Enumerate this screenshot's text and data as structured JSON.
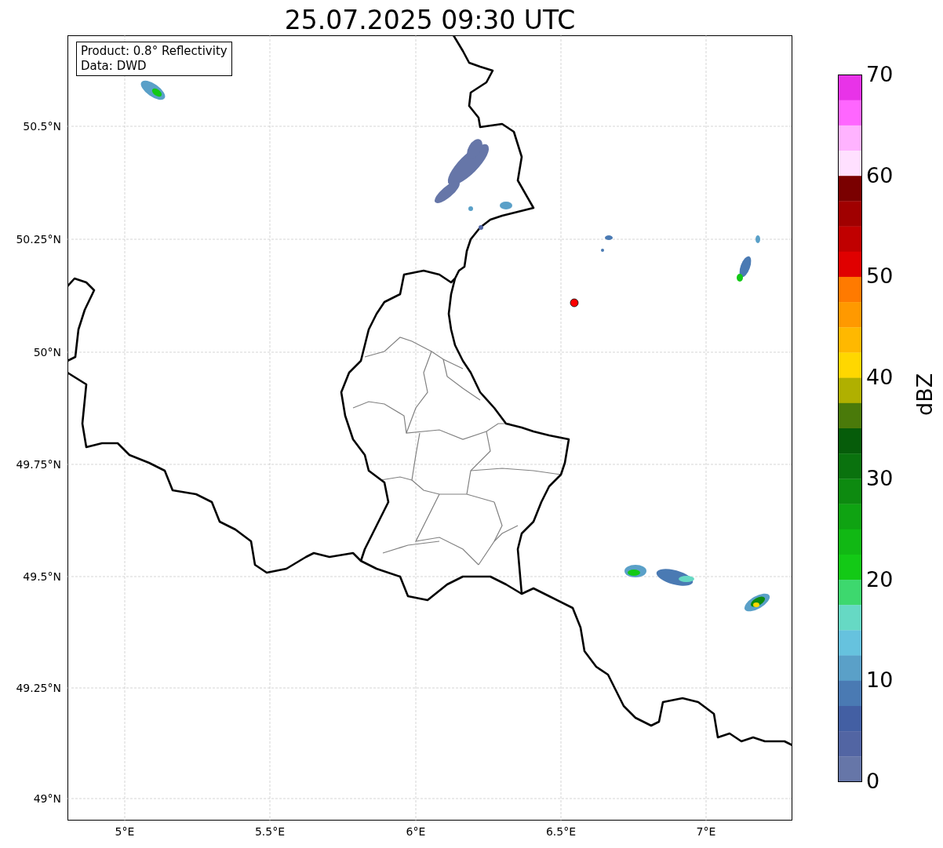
{
  "title": "25.07.2025 09:30 UTC",
  "info_box": {
    "lines": [
      "Product: 0.8° Reflectivity",
      "Data: DWD"
    ]
  },
  "map": {
    "y_ticks": [
      "50.5°N",
      "50.25°N",
      "50°N",
      "49.75°N",
      "49.5°N",
      "49.25°N",
      "49°N"
    ],
    "x_ticks": [
      "5°E",
      "5.5°E",
      "6°E",
      "6.5°E",
      "7°E"
    ]
  },
  "colorbar": {
    "label": "dBZ",
    "ticks": [
      "70",
      "60",
      "50",
      "40",
      "30",
      "20",
      "10",
      "0"
    ],
    "segments": [
      {
        "color": "#e833e8"
      },
      {
        "color": "#ff66ff"
      },
      {
        "color": "#ffb3ff"
      },
      {
        "color": "#ffe0ff"
      },
      {
        "color": "#7a0000"
      },
      {
        "color": "#a00000"
      },
      {
        "color": "#c00000"
      },
      {
        "color": "#e00000"
      },
      {
        "color": "#ff7a00"
      },
      {
        "color": "#ff9900"
      },
      {
        "color": "#ffb800"
      },
      {
        "color": "#ffd700"
      },
      {
        "color": "#b0b000"
      },
      {
        "color": "#4a7a0a"
      },
      {
        "color": "#065c0a"
      },
      {
        "color": "#0a720e"
      },
      {
        "color": "#0d8a10"
      },
      {
        "color": "#0fa312"
      },
      {
        "color": "#11b814"
      },
      {
        "color": "#13c916"
      },
      {
        "color": "#3dd86e"
      },
      {
        "color": "#66d9c4"
      },
      {
        "color": "#66c2de"
      },
      {
        "color": "#5aa0c8"
      },
      {
        "color": "#4a7ab3"
      },
      {
        "color": "#435fa3"
      },
      {
        "color": "#5265a3"
      },
      {
        "color": "#6676a8"
      }
    ]
  }
}
